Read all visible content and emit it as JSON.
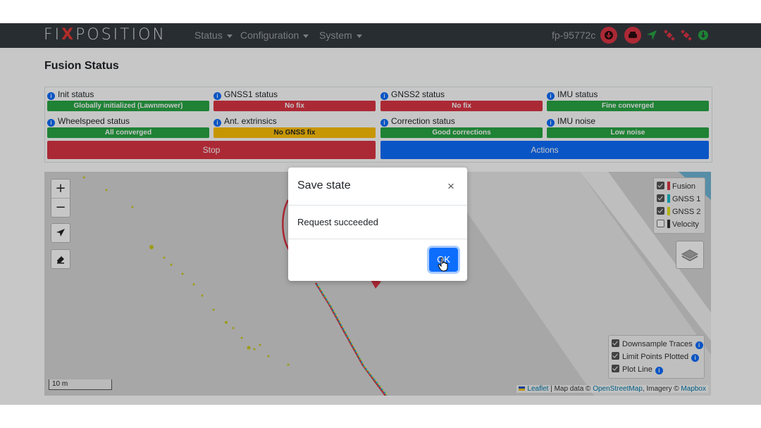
{
  "navbar": {
    "brand_left": "FI",
    "brand_x": "X",
    "brand_right": "POSITION",
    "menus": [
      "Status",
      "Configuration",
      "System"
    ],
    "hostname": "fp-95772c"
  },
  "page": {
    "title": "Fusion Status"
  },
  "statuses": [
    {
      "label": "Init status",
      "value": "Globally initialized (Lawnmower)",
      "color": "#28a745"
    },
    {
      "label": "GNSS1 status",
      "value": "No fix",
      "color": "#dc3545"
    },
    {
      "label": "GNSS2 status",
      "value": "No fix",
      "color": "#dc3545"
    },
    {
      "label": "IMU status",
      "value": "Fine converged",
      "color": "#28a745"
    },
    {
      "label": "Wheelspeed status",
      "value": "All converged",
      "color": "#28a745"
    },
    {
      "label": "Ant. extrinsics",
      "value": "No GNSS fix",
      "color": "#ffc107"
    },
    {
      "label": "Correction status",
      "value": "Good corrections",
      "color": "#28a745"
    },
    {
      "label": "IMU noise",
      "value": "Low noise",
      "color": "#28a745"
    }
  ],
  "buttons": {
    "stop": "Stop",
    "actions": "Actions"
  },
  "map": {
    "zoom_in": "+",
    "zoom_out": "−",
    "legend": [
      {
        "label": "Fusion",
        "checked": true,
        "color": "#dc3545"
      },
      {
        "label": "GNSS 1",
        "checked": true,
        "color": "#17becf"
      },
      {
        "label": "GNSS 2",
        "checked": true,
        "color": "#e6e619"
      },
      {
        "label": "Velocity",
        "checked": false,
        "color": "#333333"
      }
    ],
    "options": [
      {
        "label": "Downsample Traces",
        "checked": true
      },
      {
        "label": "Limit Points Plotted",
        "checked": true
      },
      {
        "label": "Plot Line",
        "checked": true
      }
    ],
    "scale": "10 m",
    "attribution": {
      "leaflet": "Leaflet",
      "sep1": " | Map data © ",
      "osm": "OpenStreetMap",
      "sep2": ", Imagery © ",
      "mapbox": "Mapbox"
    }
  },
  "modal": {
    "title": "Save state",
    "close": "×",
    "body": "Request succeeded",
    "ok": "OK"
  }
}
